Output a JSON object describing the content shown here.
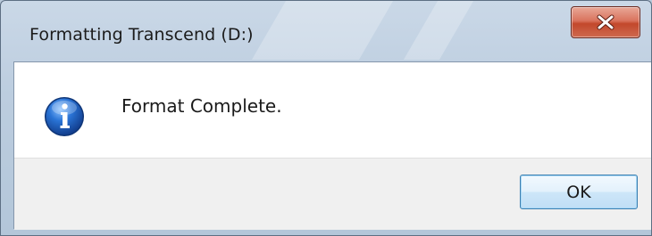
{
  "window": {
    "title": "Formatting Transcend (D:)"
  },
  "dialog": {
    "message": "Format Complete.",
    "ok_label": "OK",
    "icon": "info-icon"
  },
  "colors": {
    "close_button": "#c2482c",
    "ok_border": "#3c7fb1",
    "info_icon_blue": "#1f5fb8",
    "footer": "#f0f0f0"
  }
}
